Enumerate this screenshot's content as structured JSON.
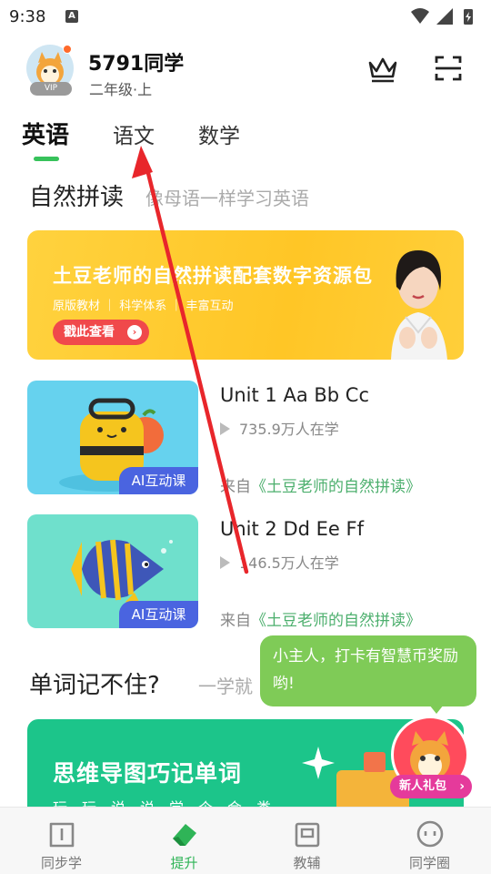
{
  "status": {
    "time": "9:38",
    "notif_letter": "A"
  },
  "header": {
    "username": "5791同学",
    "grade": "二年级·上",
    "vip_label": "VIP",
    "crown_icon": "crown-icon",
    "scan_icon": "scan-icon"
  },
  "tabs": [
    {
      "label": "英语",
      "active": true
    },
    {
      "label": "语文",
      "active": false
    },
    {
      "label": "数学",
      "active": false
    }
  ],
  "phonics": {
    "title": "自然拼读",
    "subtitle": "像母语一样学习英语",
    "banner": {
      "title": "土豆老师的自然拼读配套数字资源包",
      "tags": "原版教材 ｜ 科学体系 ｜ 丰富互动",
      "button": "戳此查看"
    }
  },
  "lessons": [
    {
      "title": "Unit 1 Aa Bb Cc",
      "learners": "735.9万人在学",
      "source_prefix": "来自",
      "source_book": "《土豆老师的自然拼读》",
      "badge": "AI互动课"
    },
    {
      "title": "Unit 2 Dd Ee Ff",
      "learners": "146.5万人在学",
      "source_prefix": "来自",
      "source_book": "《土豆老师的自然拼读》",
      "badge": "AI互动课"
    }
  ],
  "vocab": {
    "title": "单词记不住?",
    "subtitle": "一学就",
    "banner_title": "思维导图巧记单词",
    "banner_sub": "玩一玩、说一说、学一个、会一类"
  },
  "bubble": {
    "text": "小主人，打卡有智慧币奖励哟!"
  },
  "gift": {
    "label": "新人礼包",
    "chevron": "›"
  },
  "nav": [
    {
      "label": "同步学",
      "icon": "book-icon",
      "active": false
    },
    {
      "label": "提升",
      "icon": "eraser-icon",
      "active": true
    },
    {
      "label": "教辅",
      "icon": "toolbox-icon",
      "active": false
    },
    {
      "label": "同学圈",
      "icon": "chat-face-icon",
      "active": false
    }
  ],
  "colors": {
    "accent": "#37c25b",
    "banner_yellow": "#ffc626",
    "badge_blue": "#4a64e0",
    "bubble_green": "#7fcb57",
    "annotation_red": "#e8262b"
  }
}
